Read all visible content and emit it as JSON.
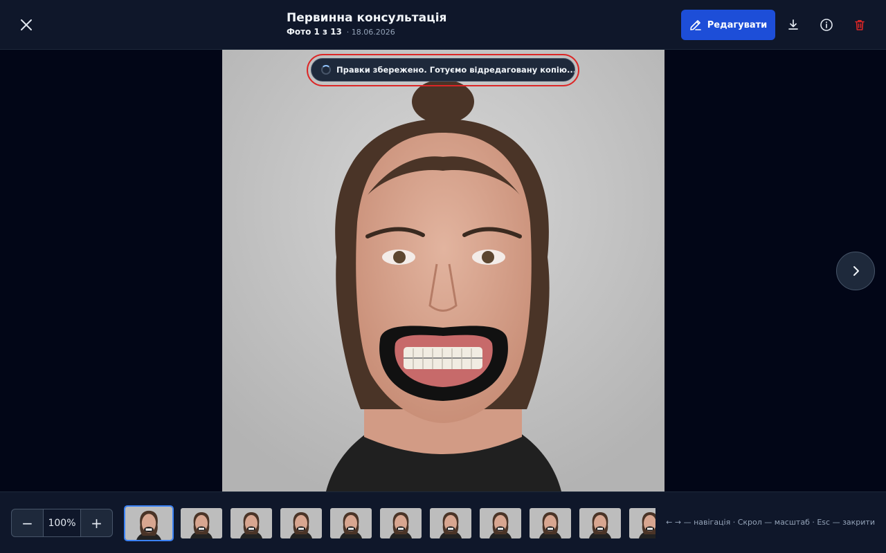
{
  "header": {
    "title": "Первинна консультація",
    "counter": "Фото 1 з 13",
    "date": "· 18.06.2026",
    "edit_label": "Редагувати",
    "icons": [
      "close-icon",
      "pencil-icon",
      "download-icon",
      "info-icon",
      "trash-icon"
    ],
    "accent_color": "#1d4ed8",
    "danger_color": "#dc2626"
  },
  "viewer": {
    "toast": "Правки збережено. Готуємо відредаговану копію...",
    "image_subject": "orthodontic intraoral-retractor portrait"
  },
  "footer": {
    "zoom_minus": "−",
    "zoom_value": "100%",
    "zoom_plus": "+",
    "thumbnail_count": 13,
    "active_thumbnail": 1,
    "hint": "← → — навігація · Скрол — масштаб · Esc — закрити"
  }
}
